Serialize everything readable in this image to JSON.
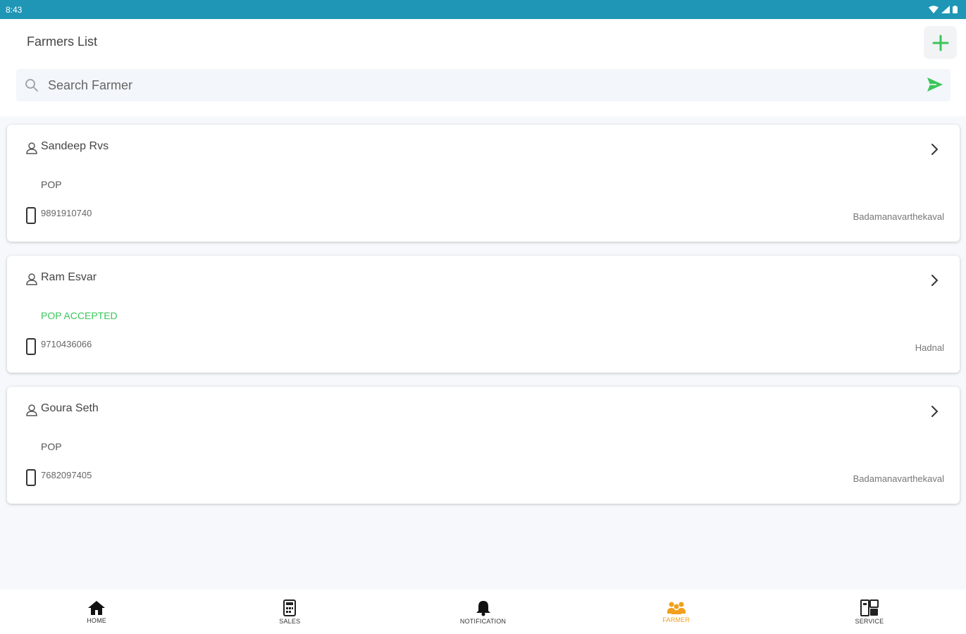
{
  "status_bar": {
    "time": "8:43"
  },
  "header": {
    "title": "Farmers List",
    "add_icon": "plus-icon",
    "search": {
      "placeholder": "Search Farmer",
      "value": "",
      "send_icon": "send-icon"
    }
  },
  "farmers": [
    {
      "name": "Sandeep Rvs",
      "status": "POP",
      "phone": "9891910740",
      "location": "Badamanavarthekaval",
      "accepted": false
    },
    {
      "name": "Ram Esvar",
      "status": "POP ACCEPTED",
      "phone": "9710436066",
      "location": "Hadnal",
      "accepted": true
    },
    {
      "name": "Goura Seth",
      "status": "POP",
      "phone": "7682097405",
      "location": "Badamanavarthekaval",
      "accepted": false
    }
  ],
  "nav": [
    {
      "label": "HOME",
      "icon": "home-icon"
    },
    {
      "label": "SALES",
      "icon": "sales-icon"
    },
    {
      "label": "NOTIFICATION",
      "icon": "bell-icon"
    },
    {
      "label": "FARMER",
      "icon": "farmer-icon",
      "active": true
    },
    {
      "label": "SERVICE",
      "icon": "service-icon"
    }
  ],
  "colors": {
    "status_bar": "#1f96b5",
    "accent_green": "#3cc55a",
    "active_nav": "#f0a01c"
  }
}
